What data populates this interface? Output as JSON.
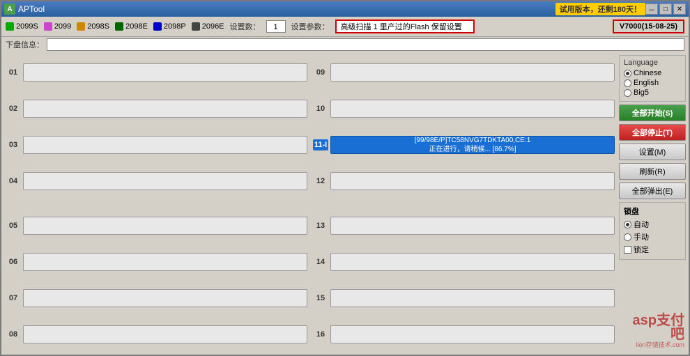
{
  "window": {
    "title": "APTool",
    "trial_text": "试用版本，还剩180天！",
    "controls": {
      "minimize": "－",
      "maximize": "□",
      "close": "✕"
    }
  },
  "toolbar": {
    "legends": [
      {
        "id": "2099S",
        "label": "2099S",
        "color": "#00aa00"
      },
      {
        "id": "2099",
        "label": "2099",
        "color": "#cc44cc"
      },
      {
        "id": "2098S",
        "label": "2098S",
        "color": "#cc8800"
      },
      {
        "id": "2098E",
        "label": "2098E",
        "color": "#006600"
      },
      {
        "id": "2098P",
        "label": "2098P",
        "color": "#0000cc"
      },
      {
        "id": "2096E",
        "label": "2096E",
        "color": "#444444"
      }
    ],
    "device_count_label": "设置数：",
    "device_count_value": "1",
    "settings_label": "设置参数：",
    "settings_value": "高级扫描 1 里产过的Flash 保留设置",
    "version": "V7000(15-08-25)"
  },
  "info_row": {
    "label": "下盘信息：",
    "value": ""
  },
  "language": {
    "title": "Language",
    "options": [
      {
        "id": "chinese",
        "label": "Chinese",
        "selected": true
      },
      {
        "id": "english",
        "label": "English",
        "selected": false
      },
      {
        "id": "big5",
        "label": "Big5",
        "selected": false
      }
    ]
  },
  "buttons": {
    "start_all": "全部开始(S)",
    "stop_all": "全部停止(T)",
    "settings": "设置(M)",
    "refresh": "刷新(R)",
    "exit_all": "全部弹出(E)"
  },
  "lock": {
    "title": "锁盘",
    "options": [
      {
        "id": "auto",
        "label": "自动",
        "type": "radio",
        "selected": true
      },
      {
        "id": "manual",
        "label": "手动",
        "type": "radio",
        "selected": false
      },
      {
        "id": "lock",
        "label": "锁定",
        "type": "checkbox",
        "checked": false
      }
    ]
  },
  "slots_left": [
    {
      "num": "01",
      "active": false,
      "text": ""
    },
    {
      "num": "02",
      "active": false,
      "text": ""
    },
    {
      "num": "03",
      "active": false,
      "text": ""
    },
    {
      "num": "04",
      "active": false,
      "text": ""
    },
    {
      "num": "05",
      "active": false,
      "text": ""
    },
    {
      "num": "06",
      "active": false,
      "text": ""
    },
    {
      "num": "07",
      "active": false,
      "text": ""
    },
    {
      "num": "08",
      "active": false,
      "text": ""
    }
  ],
  "slots_right": [
    {
      "num": "09",
      "active": false,
      "text": ""
    },
    {
      "num": "10",
      "active": false,
      "text": ""
    },
    {
      "num": "11",
      "active": true,
      "text": "[99/98E/P]TC58NVG7TDKTA00,CE:1\n正在进行，请稍候... [86.7%]"
    },
    {
      "num": "12",
      "active": false,
      "text": ""
    },
    {
      "num": "13",
      "active": false,
      "text": ""
    },
    {
      "num": "14",
      "active": false,
      "text": ""
    },
    {
      "num": "15",
      "active": false,
      "text": ""
    },
    {
      "num": "16",
      "active": false,
      "text": ""
    }
  ],
  "watermark": {
    "text": "asp支付吧",
    "sub": "lion存储技术.com"
  }
}
